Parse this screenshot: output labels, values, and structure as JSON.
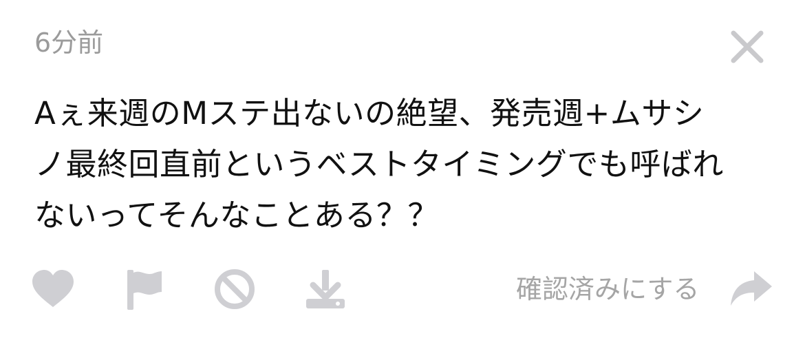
{
  "post": {
    "time_ago": "6分前",
    "lines": [
      "Aぇ来週のMステ出ないの絶望、発売週+ムサシ",
      "ノ最終回直前というベストタイミングでも呼ばれ",
      "ないってそんなことある？？"
    ]
  },
  "actions": {
    "like_icon": "heart-icon",
    "flag_icon": "flag-icon",
    "block_icon": "block-icon",
    "save_icon": "download-icon",
    "mark_read_label": "確認済みにする",
    "share_icon": "share-arrow-icon",
    "icon_color": "#cfcfd3"
  },
  "header": {
    "close_icon": "close-icon"
  }
}
